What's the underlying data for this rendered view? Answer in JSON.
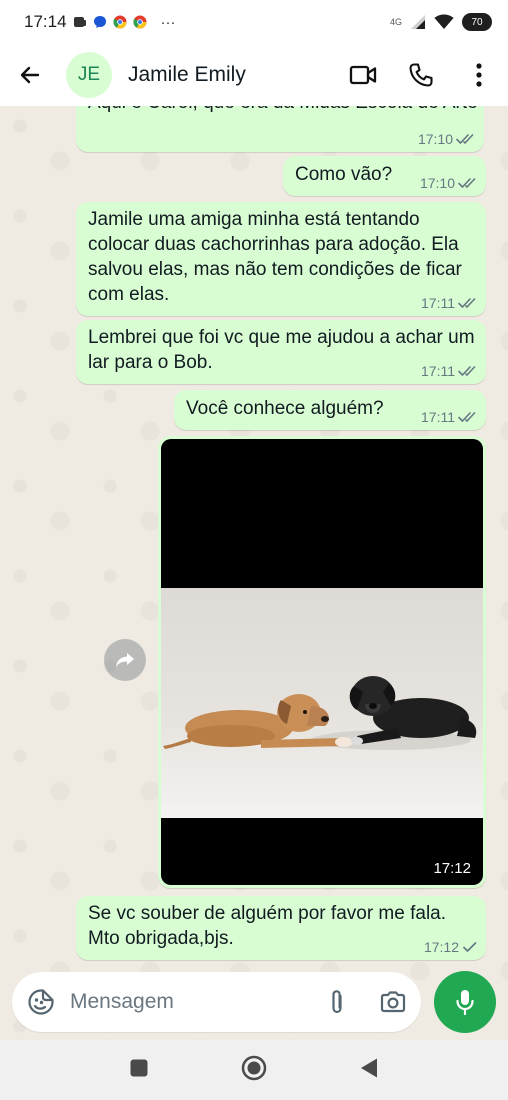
{
  "status_bar": {
    "time": "17:14",
    "more": "···",
    "network": "4G",
    "battery": "70"
  },
  "header": {
    "avatar_initials": "JE",
    "contact_name": "Jamile Emily"
  },
  "messages": [
    {
      "text": "Aqui é Carol, que era da Midas Escola de Arte",
      "time": "17:10"
    },
    {
      "text": "Como vão?",
      "time": "17:10"
    },
    {
      "text": "Jamile uma amiga minha está tentando colocar duas cachorrinhas para adoção. Ela salvou elas, mas não tem condições de ficar com elas.",
      "time": "17:11"
    },
    {
      "text": "Lembrei que foi vc que me ajudou a achar um lar para o Bob.",
      "time": "17:11"
    },
    {
      "text": "Você conhece alguém?",
      "time": "17:11"
    },
    {
      "text": "",
      "time": "17:12"
    },
    {
      "text": "Se vc souber de alguém por favor me fala. Mto obrigada,bjs.",
      "time": "17:12"
    }
  ],
  "input": {
    "placeholder": "Mensagem",
    "value": ""
  },
  "colors": {
    "accent": "#21a852",
    "bubble_out": "#d9fdd3",
    "read_ticks": "#667781"
  }
}
